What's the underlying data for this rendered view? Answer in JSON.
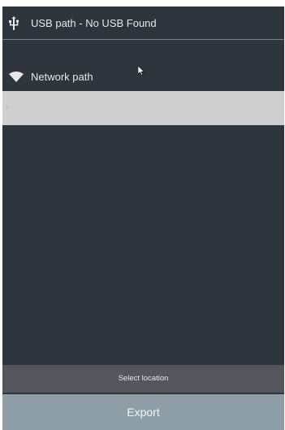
{
  "usb": {
    "icon": "usb-icon",
    "label": "USB path - No USB Found"
  },
  "network": {
    "icon": "wifi-icon",
    "label": "Network path",
    "selector_value": ""
  },
  "footer": {
    "select_location_label": "Select location",
    "export_label": "Export"
  },
  "colors": {
    "panel_bg": "#2f353c",
    "selector_bg": "#cfcfcf",
    "select_bar_bg": "#53575c",
    "export_bg": "#8e9ea6",
    "text": "#e6e8ea"
  }
}
